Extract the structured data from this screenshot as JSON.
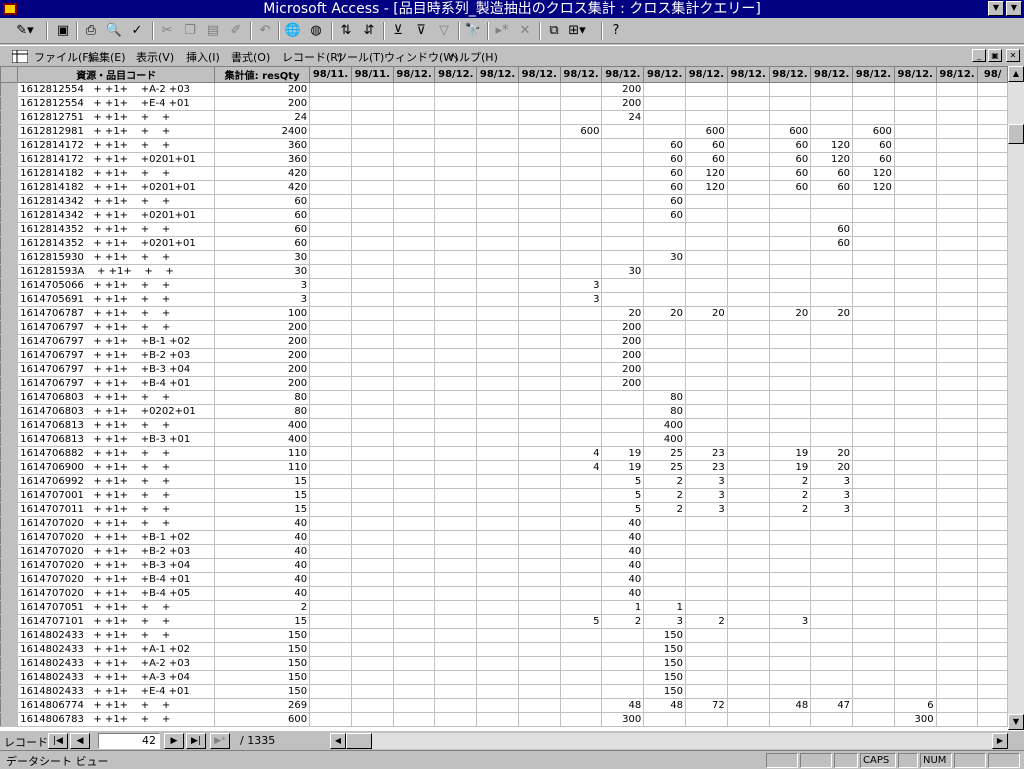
{
  "window": {
    "title": "Microsoft Access - [品目時系列_製造抽出のクロス集計 : クロス集計クエリー]"
  },
  "menu": {
    "items": [
      "ファイル(F)",
      "編集(E)",
      "表示(V)",
      "挿入(I)",
      "書式(O)",
      "レコード(R)",
      "ツール(T)",
      "ウィンドウ(W)",
      "ヘルプ(H)"
    ]
  },
  "grid": {
    "headers": [
      "資源・品目コード",
      "集計値: resQty",
      "98/11.",
      "98/11.",
      "98/12.",
      "98/12.",
      "98/12.",
      "98/12.",
      "98/12.",
      "98/12.",
      "98/12.",
      "98/12.",
      "98/12.",
      "98/12.",
      "98/12.",
      "98/12.",
      "98/12.",
      "98/12.",
      "98/"
    ],
    "rows": [
      [
        "1612812554   + +1+    +A-2 +03",
        "200",
        "",
        "",
        "",
        "",
        "",
        "",
        "",
        "200",
        "",
        "",
        "",
        "",
        "",
        "",
        "",
        "",
        ""
      ],
      [
        "1612812554   + +1+    +E-4 +01",
        "200",
        "",
        "",
        "",
        "",
        "",
        "",
        "",
        "200",
        "",
        "",
        "",
        "",
        "",
        "",
        "",
        "",
        ""
      ],
      [
        "1612812751   + +1+    +    +",
        "24",
        "",
        "",
        "",
        "",
        "",
        "",
        "",
        "24",
        "",
        "",
        "",
        "",
        "",
        "",
        "",
        "",
        ""
      ],
      [
        "1612812981   + +1+    +    +",
        "2400",
        "",
        "",
        "",
        "",
        "",
        "",
        "600",
        "",
        "",
        "600",
        "",
        "600",
        "",
        "600",
        "",
        "",
        ""
      ],
      [
        "1612814172   + +1+    +    +",
        "360",
        "",
        "",
        "",
        "",
        "",
        "",
        "",
        "",
        "60",
        "60",
        "",
        "60",
        "120",
        "60",
        "",
        "",
        ""
      ],
      [
        "1612814172   + +1+    +0201+01",
        "360",
        "",
        "",
        "",
        "",
        "",
        "",
        "",
        "",
        "60",
        "60",
        "",
        "60",
        "120",
        "60",
        "",
        "",
        ""
      ],
      [
        "1612814182   + +1+    +    +",
        "420",
        "",
        "",
        "",
        "",
        "",
        "",
        "",
        "",
        "60",
        "120",
        "",
        "60",
        "60",
        "120",
        "",
        "",
        ""
      ],
      [
        "1612814182   + +1+    +0201+01",
        "420",
        "",
        "",
        "",
        "",
        "",
        "",
        "",
        "",
        "60",
        "120",
        "",
        "60",
        "60",
        "120",
        "",
        "",
        ""
      ],
      [
        "1612814342   + +1+    +    +",
        "60",
        "",
        "",
        "",
        "",
        "",
        "",
        "",
        "",
        "60",
        "",
        "",
        "",
        "",
        "",
        "",
        "",
        ""
      ],
      [
        "1612814342   + +1+    +0201+01",
        "60",
        "",
        "",
        "",
        "",
        "",
        "",
        "",
        "",
        "60",
        "",
        "",
        "",
        "",
        "",
        "",
        "",
        ""
      ],
      [
        "1612814352   + +1+    +    +",
        "60",
        "",
        "",
        "",
        "",
        "",
        "",
        "",
        "",
        "",
        "",
        "",
        "",
        "60",
        "",
        "",
        "",
        ""
      ],
      [
        "1612814352   + +1+    +0201+01",
        "60",
        "",
        "",
        "",
        "",
        "",
        "",
        "",
        "",
        "",
        "",
        "",
        "",
        "60",
        "",
        "",
        "",
        ""
      ],
      [
        "1612815930   + +1+    +    +",
        "30",
        "",
        "",
        "",
        "",
        "",
        "",
        "",
        "",
        "30",
        "",
        "",
        "",
        "",
        "",
        "",
        "",
        ""
      ],
      [
        "161281593A    + +1+    +    +",
        "30",
        "",
        "",
        "",
        "",
        "",
        "",
        "",
        "30",
        "",
        "",
        "",
        "",
        "",
        "",
        "",
        "",
        ""
      ],
      [
        "1614705066   + +1+    +    +",
        "3",
        "",
        "",
        "",
        "",
        "",
        "",
        "3",
        "",
        "",
        "",
        "",
        "",
        "",
        "",
        "",
        "",
        ""
      ],
      [
        "1614705691   + +1+    +    +",
        "3",
        "",
        "",
        "",
        "",
        "",
        "",
        "3",
        "",
        "",
        "",
        "",
        "",
        "",
        "",
        "",
        "",
        ""
      ],
      [
        "1614706787   + +1+    +    +",
        "100",
        "",
        "",
        "",
        "",
        "",
        "",
        "",
        "20",
        "20",
        "20",
        "",
        "20",
        "20",
        "",
        "",
        "",
        ""
      ],
      [
        "1614706797   + +1+    +    +",
        "200",
        "",
        "",
        "",
        "",
        "",
        "",
        "",
        "200",
        "",
        "",
        "",
        "",
        "",
        "",
        "",
        "",
        ""
      ],
      [
        "1614706797   + +1+    +B-1 +02",
        "200",
        "",
        "",
        "",
        "",
        "",
        "",
        "",
        "200",
        "",
        "",
        "",
        "",
        "",
        "",
        "",
        "",
        ""
      ],
      [
        "1614706797   + +1+    +B-2 +03",
        "200",
        "",
        "",
        "",
        "",
        "",
        "",
        "",
        "200",
        "",
        "",
        "",
        "",
        "",
        "",
        "",
        "",
        ""
      ],
      [
        "1614706797   + +1+    +B-3 +04",
        "200",
        "",
        "",
        "",
        "",
        "",
        "",
        "",
        "200",
        "",
        "",
        "",
        "",
        "",
        "",
        "",
        "",
        ""
      ],
      [
        "1614706797   + +1+    +B-4 +01",
        "200",
        "",
        "",
        "",
        "",
        "",
        "",
        "",
        "200",
        "",
        "",
        "",
        "",
        "",
        "",
        "",
        "",
        ""
      ],
      [
        "1614706803   + +1+    +    +",
        "80",
        "",
        "",
        "",
        "",
        "",
        "",
        "",
        "",
        "80",
        "",
        "",
        "",
        "",
        "",
        "",
        "",
        ""
      ],
      [
        "1614706803   + +1+    +0202+01",
        "80",
        "",
        "",
        "",
        "",
        "",
        "",
        "",
        "",
        "80",
        "",
        "",
        "",
        "",
        "",
        "",
        "",
        ""
      ],
      [
        "1614706813   + +1+    +    +",
        "400",
        "",
        "",
        "",
        "",
        "",
        "",
        "",
        "",
        "400",
        "",
        "",
        "",
        "",
        "",
        "",
        "",
        ""
      ],
      [
        "1614706813   + +1+    +B-3 +01",
        "400",
        "",
        "",
        "",
        "",
        "",
        "",
        "",
        "",
        "400",
        "",
        "",
        "",
        "",
        "",
        "",
        "",
        ""
      ],
      [
        "1614706882   + +1+    +    +",
        "110",
        "",
        "",
        "",
        "",
        "",
        "",
        "4",
        "19",
        "25",
        "23",
        "",
        "19",
        "20",
        "",
        "",
        "",
        ""
      ],
      [
        "1614706900   + +1+    +    +",
        "110",
        "",
        "",
        "",
        "",
        "",
        "",
        "4",
        "19",
        "25",
        "23",
        "",
        "19",
        "20",
        "",
        "",
        "",
        ""
      ],
      [
        "1614706992   + +1+    +    +",
        "15",
        "",
        "",
        "",
        "",
        "",
        "",
        "",
        "5",
        "2",
        "3",
        "",
        "2",
        "3",
        "",
        "",
        "",
        ""
      ],
      [
        "1614707001   + +1+    +    +",
        "15",
        "",
        "",
        "",
        "",
        "",
        "",
        "",
        "5",
        "2",
        "3",
        "",
        "2",
        "3",
        "",
        "",
        "",
        ""
      ],
      [
        "1614707011   + +1+    +    +",
        "15",
        "",
        "",
        "",
        "",
        "",
        "",
        "",
        "5",
        "2",
        "3",
        "",
        "2",
        "3",
        "",
        "",
        "",
        ""
      ],
      [
        "1614707020   + +1+    +    +",
        "40",
        "",
        "",
        "",
        "",
        "",
        "",
        "",
        "40",
        "",
        "",
        "",
        "",
        "",
        "",
        "",
        "",
        ""
      ],
      [
        "1614707020   + +1+    +B-1 +02",
        "40",
        "",
        "",
        "",
        "",
        "",
        "",
        "",
        "40",
        "",
        "",
        "",
        "",
        "",
        "",
        "",
        "",
        ""
      ],
      [
        "1614707020   + +1+    +B-2 +03",
        "40",
        "",
        "",
        "",
        "",
        "",
        "",
        "",
        "40",
        "",
        "",
        "",
        "",
        "",
        "",
        "",
        "",
        ""
      ],
      [
        "1614707020   + +1+    +B-3 +04",
        "40",
        "",
        "",
        "",
        "",
        "",
        "",
        "",
        "40",
        "",
        "",
        "",
        "",
        "",
        "",
        "",
        "",
        ""
      ],
      [
        "1614707020   + +1+    +B-4 +01",
        "40",
        "",
        "",
        "",
        "",
        "",
        "",
        "",
        "40",
        "",
        "",
        "",
        "",
        "",
        "",
        "",
        "",
        ""
      ],
      [
        "1614707020   + +1+    +B-4 +05",
        "40",
        "",
        "",
        "",
        "",
        "",
        "",
        "",
        "40",
        "",
        "",
        "",
        "",
        "",
        "",
        "",
        "",
        ""
      ],
      [
        "1614707051   + +1+    +    +",
        "2",
        "",
        "",
        "",
        "",
        "",
        "",
        "",
        "1",
        "1",
        "",
        "",
        "",
        "",
        "",
        "",
        "",
        ""
      ],
      [
        "1614707101   + +1+    +    +",
        "15",
        "",
        "",
        "",
        "",
        "",
        "",
        "5",
        "2",
        "3",
        "2",
        "",
        "3",
        "",
        "",
        "",
        "",
        ""
      ],
      [
        "1614802433   + +1+    +    +",
        "150",
        "",
        "",
        "",
        "",
        "",
        "",
        "",
        "",
        "150",
        "",
        "",
        "",
        "",
        "",
        "",
        "",
        ""
      ],
      [
        "1614802433   + +1+    +A-1 +02",
        "150",
        "",
        "",
        "",
        "",
        "",
        "",
        "",
        "",
        "150",
        "",
        "",
        "",
        "",
        "",
        "",
        "",
        ""
      ],
      [
        "1614802433   + +1+    +A-2 +03",
        "150",
        "",
        "",
        "",
        "",
        "",
        "",
        "",
        "",
        "150",
        "",
        "",
        "",
        "",
        "",
        "",
        "",
        ""
      ],
      [
        "1614802433   + +1+    +A-3 +04",
        "150",
        "",
        "",
        "",
        "",
        "",
        "",
        "",
        "",
        "150",
        "",
        "",
        "",
        "",
        "",
        "",
        "",
        ""
      ],
      [
        "1614802433   + +1+    +E-4 +01",
        "150",
        "",
        "",
        "",
        "",
        "",
        "",
        "",
        "",
        "150",
        "",
        "",
        "",
        "",
        "",
        "",
        "",
        ""
      ],
      [
        "1614806774   + +1+    +    +",
        "269",
        "",
        "",
        "",
        "",
        "",
        "",
        "",
        "48",
        "48",
        "72",
        "",
        "48",
        "47",
        "",
        "6",
        "",
        ""
      ],
      [
        "1614806783   + +1+    +    +",
        "600",
        "",
        "",
        "",
        "",
        "",
        "",
        "",
        "300",
        "",
        "",
        "",
        "",
        "",
        "",
        "300",
        "",
        ""
      ]
    ]
  },
  "nav": {
    "label": "レコード:",
    "current": "42",
    "total": "/ 1335"
  },
  "status": {
    "text": "データシート ビュー",
    "caps": "CAPS",
    "num": "NUM"
  }
}
